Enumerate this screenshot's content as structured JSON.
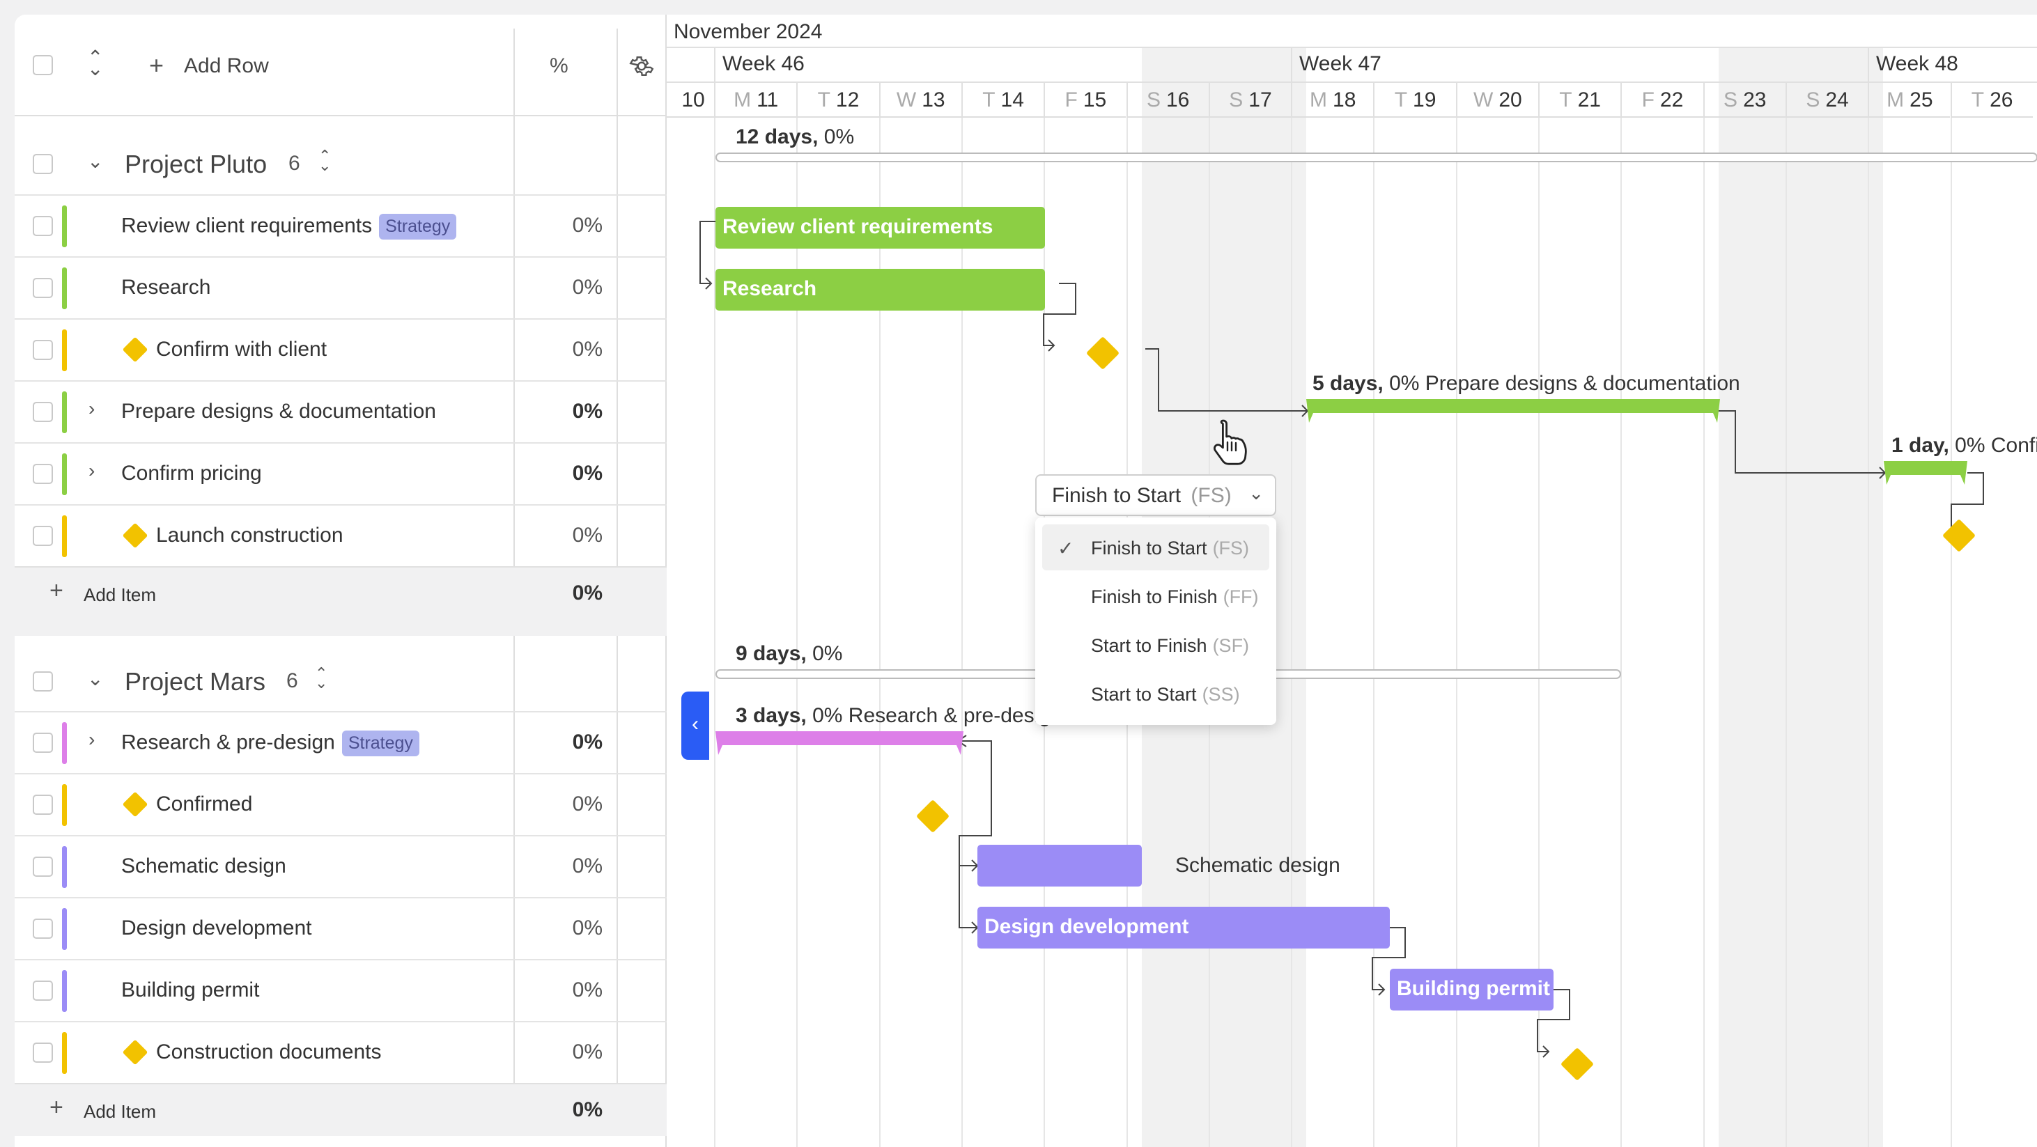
{
  "header": {
    "add_row": "Add Row",
    "percent_header": "%"
  },
  "groups": [
    {
      "name": "Project Pluto",
      "count": "6",
      "add_item": "Add Item",
      "total_pct": "0%",
      "tasks": [
        {
          "name": "Review client requirements",
          "tag": "Strategy",
          "pct": "0%"
        },
        {
          "name": "Research",
          "pct": "0%"
        },
        {
          "name": "Confirm with client",
          "pct": "0%"
        },
        {
          "name": "Prepare designs & documentation",
          "pct": "0%"
        },
        {
          "name": "Confirm pricing",
          "pct": "0%"
        },
        {
          "name": "Launch construction",
          "pct": "0%"
        }
      ]
    },
    {
      "name": "Project Mars",
      "count": "6",
      "add_item": "Add Item",
      "total_pct": "0%",
      "tasks": [
        {
          "name": "Research & pre-design",
          "tag": "Strategy",
          "pct": "0%"
        },
        {
          "name": "Confirmed",
          "pct": "0%"
        },
        {
          "name": "Schematic design",
          "pct": "0%"
        },
        {
          "name": "Design development",
          "pct": "0%"
        },
        {
          "name": "Building permit",
          "pct": "0%"
        },
        {
          "name": "Construction documents",
          "pct": "0%"
        }
      ]
    }
  ],
  "timeline": {
    "month": "November 2024",
    "weeks": [
      "Week 46",
      "Week 47",
      "Week 48"
    ],
    "days": [
      {
        "l": "",
        "n": "10"
      },
      {
        "l": "M",
        "n": "11"
      },
      {
        "l": "T",
        "n": "12"
      },
      {
        "l": "W",
        "n": "13"
      },
      {
        "l": "T",
        "n": "14"
      },
      {
        "l": "F",
        "n": "15"
      },
      {
        "l": "S",
        "n": "16"
      },
      {
        "l": "S",
        "n": "17"
      },
      {
        "l": "M",
        "n": "18"
      },
      {
        "l": "T",
        "n": "19"
      },
      {
        "l": "W",
        "n": "20"
      },
      {
        "l": "T",
        "n": "21"
      },
      {
        "l": "F",
        "n": "22"
      },
      {
        "l": "S",
        "n": "23"
      },
      {
        "l": "S",
        "n": "24"
      },
      {
        "l": "M",
        "n": "25"
      },
      {
        "l": "T",
        "n": "26"
      }
    ]
  },
  "gantt": {
    "pluto_summary": {
      "days": "12 days,",
      "pct": "0%"
    },
    "review_bar": "Review client requirements",
    "research_bar": "Research",
    "prepare_label": {
      "days": "5 days,",
      "pct": "0%",
      "name": "Prepare designs & documentation"
    },
    "pricing_label": {
      "days": "1 day,",
      "pct": "0%",
      "name": "Confirm pricing"
    },
    "mars_summary": {
      "days": "9 days,",
      "pct": "0%"
    },
    "research_pre_label": {
      "days": "3 days,",
      "pct": "0%",
      "name": "Research & pre-design"
    },
    "schematic_label": "Schematic design",
    "design_dev_bar": "Design development",
    "building_permit_bar": "Building permit"
  },
  "dependency_dropdown": {
    "selected": "Finish to Start",
    "selected_abbr": "(FS)",
    "options": [
      {
        "label": "Finish to Start",
        "abbr": "(FS)"
      },
      {
        "label": "Finish to Finish",
        "abbr": "(FF)"
      },
      {
        "label": "Start to Finish",
        "abbr": "(SF)"
      },
      {
        "label": "Start to Start",
        "abbr": "(SS)"
      }
    ]
  },
  "colors": {
    "green": "#8ccf44",
    "yellow": "#f2c200",
    "purple": "#9b8cf6",
    "pink": "#dd7fe8",
    "accent": "#2a5cf5"
  },
  "icons": [
    "expand-collapse-icon",
    "plus-icon",
    "gear-icon",
    "chevron-down-icon",
    "chevron-right-icon",
    "sort-icon",
    "check-icon",
    "hand-cursor-icon",
    "chevron-left-icon"
  ]
}
